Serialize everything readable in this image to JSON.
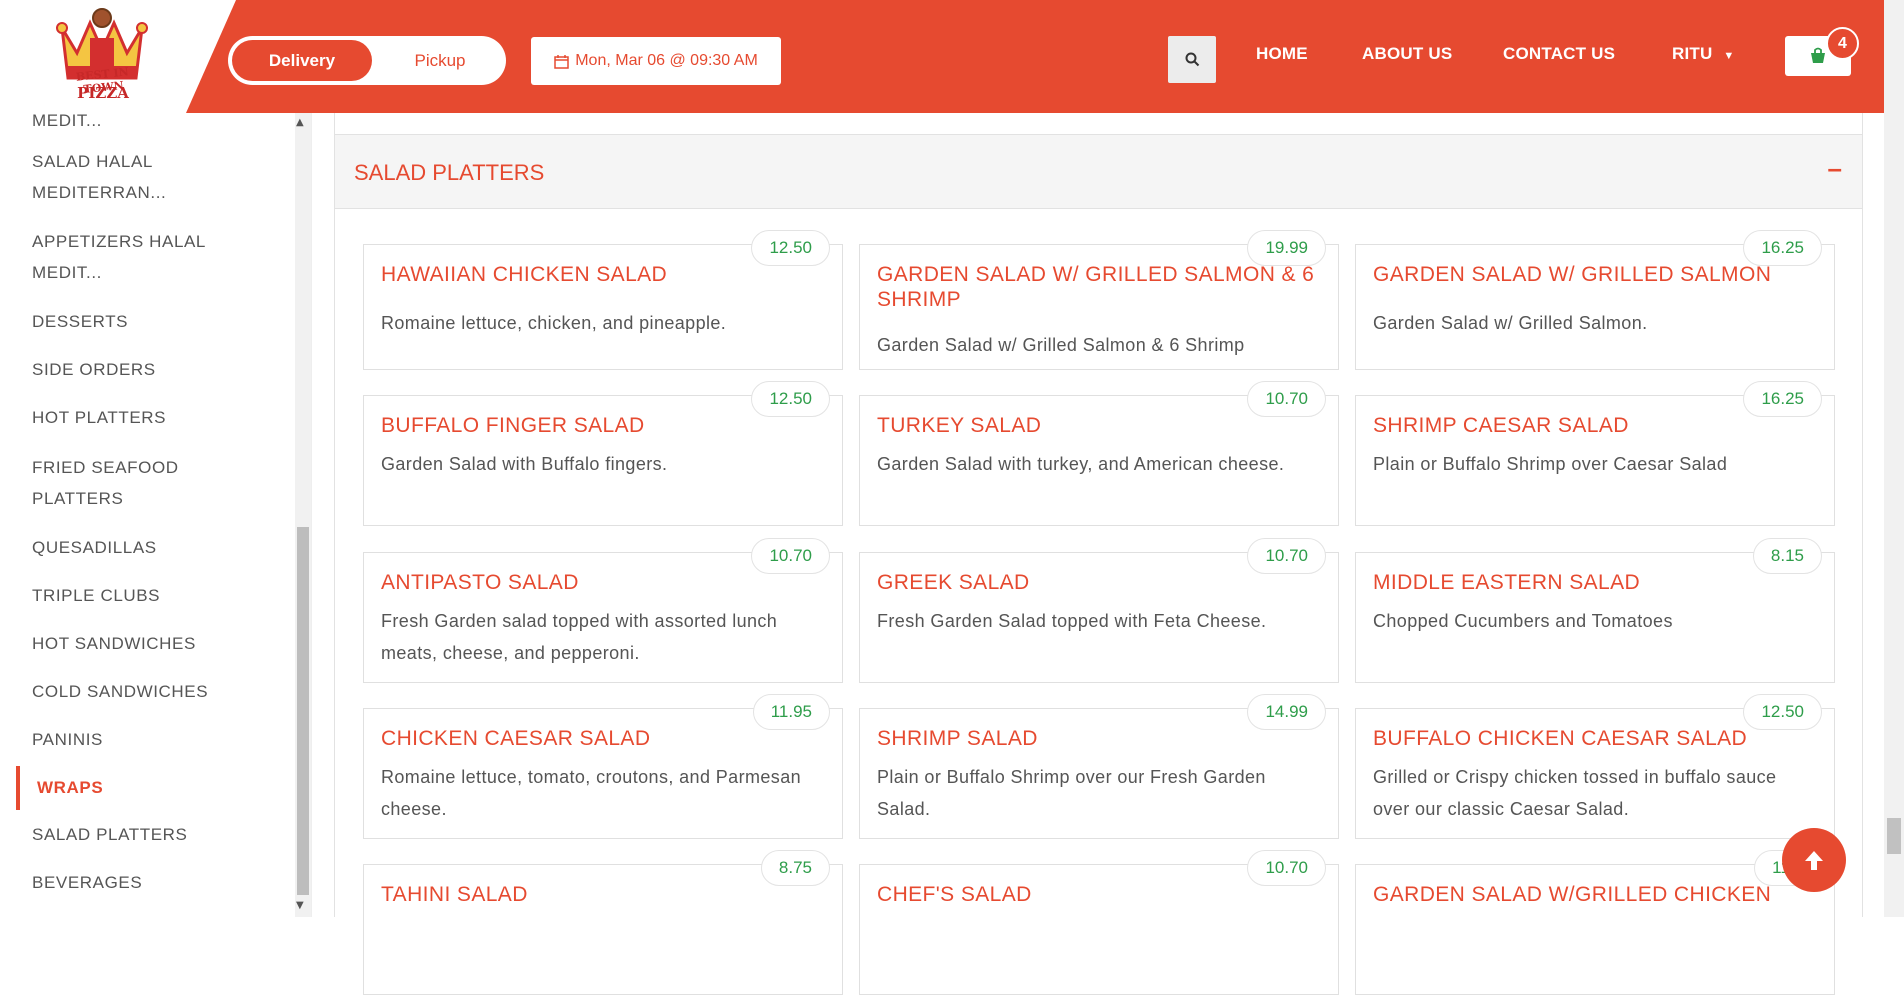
{
  "brand": {
    "logo_line1": "BEST IN TOWN",
    "logo_line2": "PIZZA"
  },
  "header": {
    "order_type": {
      "delivery": "Delivery",
      "pickup": "Pickup",
      "selected": "Delivery"
    },
    "datetime": "Mon, Mar 06 @ 09:30 AM",
    "nav": [
      "HOME",
      "ABOUT US",
      "CONTACT US"
    ],
    "user": "RITU",
    "cart_count": "4"
  },
  "sidebar": {
    "items": [
      {
        "label": "MEDIT...",
        "lines": [
          "MEDIT..."
        ]
      },
      {
        "label": "SALAD HALAL MEDITERRAN...",
        "lines": [
          "SALAD HALAL",
          "MEDITERRAN..."
        ]
      },
      {
        "label": "APPETIZERS HALAL MEDIT...",
        "lines": [
          "APPETIZERS HALAL",
          "MEDIT..."
        ]
      },
      {
        "label": "DESSERTS",
        "lines": [
          "DESSERTS"
        ]
      },
      {
        "label": "SIDE ORDERS",
        "lines": [
          "SIDE ORDERS"
        ]
      },
      {
        "label": "HOT PLATTERS",
        "lines": [
          "HOT PLATTERS"
        ]
      },
      {
        "label": "FRIED SEAFOOD PLATTERS",
        "lines": [
          "FRIED SEAFOOD",
          "PLATTERS"
        ]
      },
      {
        "label": "QUESADILLAS",
        "lines": [
          "QUESADILLAS"
        ]
      },
      {
        "label": "TRIPLE CLUBS",
        "lines": [
          "TRIPLE CLUBS"
        ]
      },
      {
        "label": "HOT SANDWICHES",
        "lines": [
          "HOT SANDWICHES"
        ]
      },
      {
        "label": "COLD SANDWICHES",
        "lines": [
          "COLD SANDWICHES"
        ]
      },
      {
        "label": "PANINIS",
        "lines": [
          "PANINIS"
        ]
      },
      {
        "label": "WRAPS",
        "lines": [
          "WRAPS"
        ],
        "active": true
      },
      {
        "label": "SALAD PLATTERS",
        "lines": [
          "SALAD PLATTERS"
        ]
      },
      {
        "label": "BEVERAGES",
        "lines": [
          "BEVERAGES"
        ]
      }
    ]
  },
  "section": {
    "title": "SALAD PLATTERS",
    "collapse_symbol": "–",
    "items": [
      {
        "name": "HAWAIIAN CHICKEN SALAD",
        "price": "12.50",
        "desc": "Romaine lettuce, chicken, and pineapple."
      },
      {
        "name": "GARDEN SALAD W/ GRILLED SALMON & 6 SHRIMP",
        "price": "19.99",
        "desc": "Garden Salad w/ Grilled Salmon & 6 Shrimp"
      },
      {
        "name": "GARDEN SALAD W/ GRILLED SALMON",
        "price": "16.25",
        "desc": "Garden Salad w/ Grilled Salmon."
      },
      {
        "name": "BUFFALO FINGER SALAD",
        "price": "12.50",
        "desc": "Garden Salad with Buffalo fingers."
      },
      {
        "name": "TURKEY SALAD",
        "price": "10.70",
        "desc": "Garden Salad with turkey, and American cheese."
      },
      {
        "name": "SHRIMP CAESAR SALAD",
        "price": "16.25",
        "desc": "Plain or Buffalo Shrimp over Caesar Salad"
      },
      {
        "name": "ANTIPASTO SALAD",
        "price": "10.70",
        "desc": "Fresh Garden salad topped with assorted lunch meats, cheese, and pepperoni."
      },
      {
        "name": "GREEK SALAD",
        "price": "10.70",
        "desc": "Fresh Garden Salad topped with Feta Cheese."
      },
      {
        "name": "MIDDLE EASTERN SALAD",
        "price": "8.15",
        "desc": "Chopped Cucumbers and Tomatoes"
      },
      {
        "name": "CHICKEN CAESAR SALAD",
        "price": "11.95",
        "desc": "Romaine lettuce, tomato, croutons, and Parmesan cheese."
      },
      {
        "name": "SHRIMP SALAD",
        "price": "14.99",
        "desc": "Plain or Buffalo Shrimp over our Fresh Garden Salad."
      },
      {
        "name": "BUFFALO CHICKEN CAESAR SALAD",
        "price": "12.50",
        "desc": "Grilled or Crispy chicken tossed in buffalo sauce over our classic Caesar Salad."
      },
      {
        "name": "TAHINI SALAD",
        "price": "8.75",
        "desc": ""
      },
      {
        "name": "CHEF'S SALAD",
        "price": "10.70",
        "desc": ""
      },
      {
        "name": "GARDEN SALAD W/GRILLED CHICKEN",
        "price": "11.5",
        "desc": ""
      }
    ]
  },
  "colors": {
    "brand": "#e64a30",
    "price": "#2e9d4a",
    "text": "#555555"
  },
  "icons": {
    "search": "search-icon",
    "cart": "cart-icon",
    "calendar": "calendar-icon",
    "back_to_top": "arrow-up-icon"
  }
}
